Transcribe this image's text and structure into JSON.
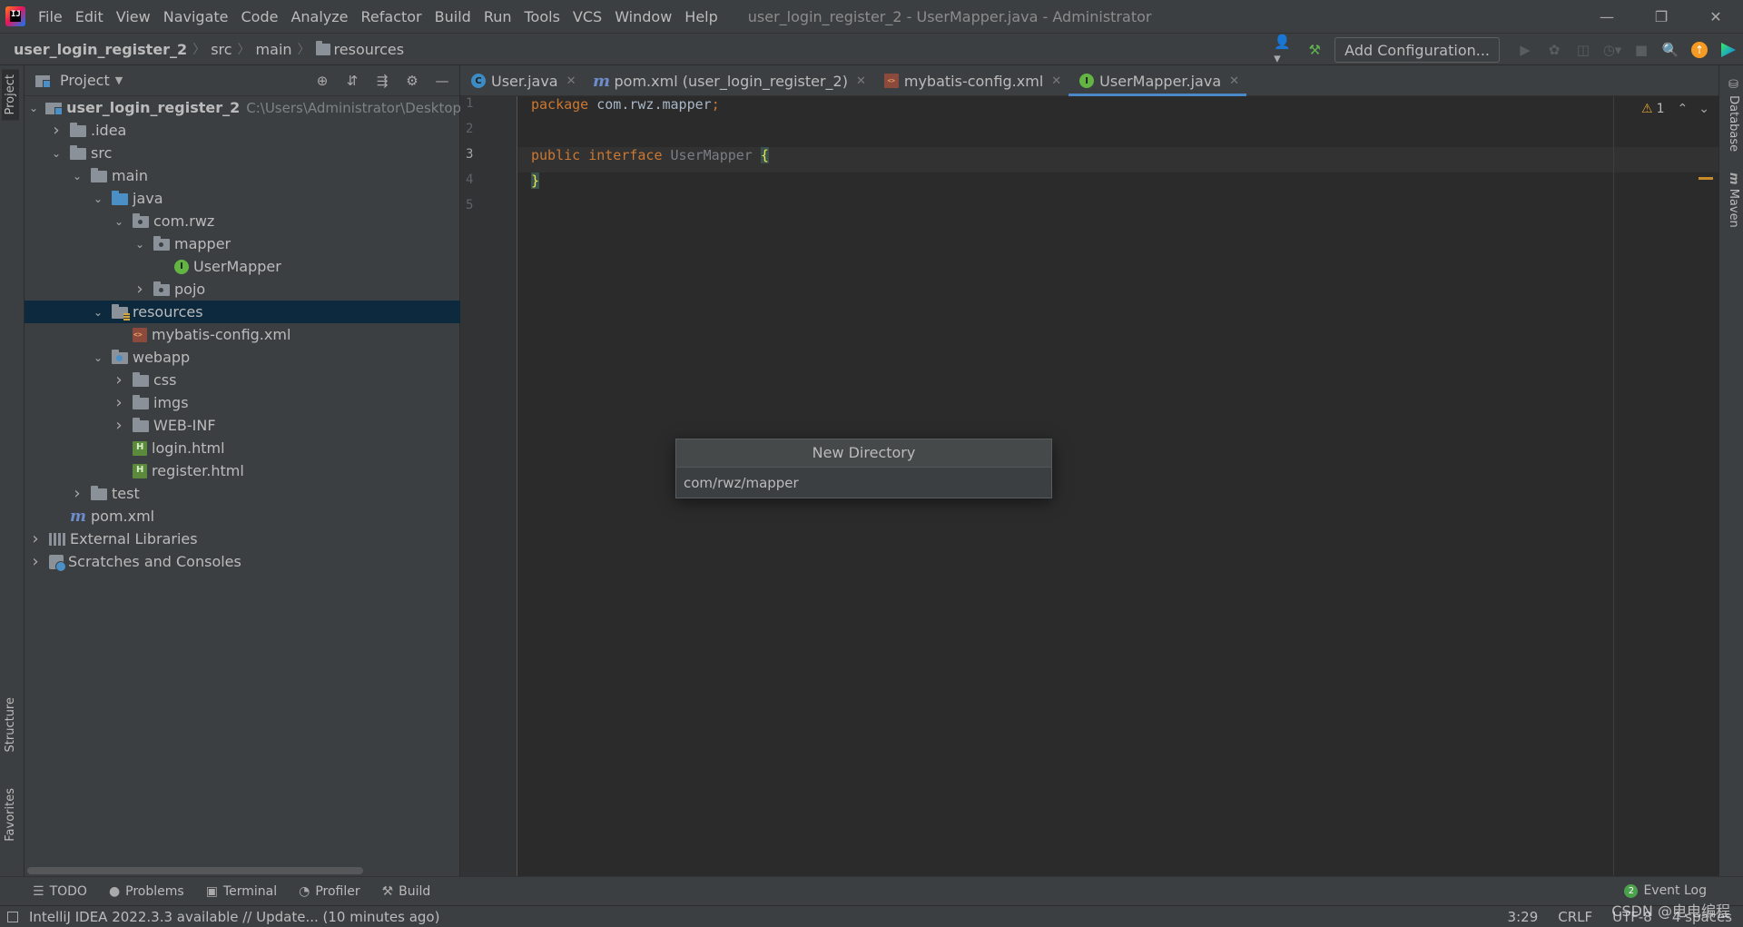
{
  "app": {
    "logo_text": "IJ",
    "window_title": "user_login_register_2 - UserMapper.java - Administrator"
  },
  "menu": [
    "File",
    "Edit",
    "View",
    "Navigate",
    "Code",
    "Analyze",
    "Refactor",
    "Build",
    "Run",
    "Tools",
    "VCS",
    "Window",
    "Help"
  ],
  "breadcrumb": [
    "user_login_register_2",
    "src",
    "main",
    "resources"
  ],
  "toolbar": {
    "add_configuration": "Add Configuration..."
  },
  "stripes": {
    "project": "Project",
    "structure": "Structure",
    "favorites": "Favorites",
    "database": "Database",
    "maven": "Maven"
  },
  "project": {
    "title": "Project",
    "tree": [
      {
        "label": "user_login_register_2",
        "path": "C:\\Users\\Administrator\\Desktop\\user",
        "depth": 0,
        "expanded": true,
        "icon": "module-folder-icon",
        "bold": true
      },
      {
        "label": ".idea",
        "depth": 1,
        "expanded": false,
        "icon": "folder-icon"
      },
      {
        "label": "src",
        "depth": 1,
        "expanded": true,
        "icon": "folder-icon"
      },
      {
        "label": "main",
        "depth": 2,
        "expanded": true,
        "icon": "folder-icon"
      },
      {
        "label": "java",
        "depth": 3,
        "expanded": true,
        "icon": "source-folder-icon"
      },
      {
        "label": "com.rwz",
        "depth": 4,
        "expanded": true,
        "icon": "package-icon"
      },
      {
        "label": "mapper",
        "depth": 5,
        "expanded": true,
        "icon": "package-icon"
      },
      {
        "label": "UserMapper",
        "depth": 6,
        "leaf": true,
        "icon": "interface-icon"
      },
      {
        "label": "pojo",
        "depth": 5,
        "expanded": false,
        "icon": "package-icon"
      },
      {
        "label": "resources",
        "depth": 3,
        "expanded": true,
        "icon": "resources-folder-icon",
        "selected": true
      },
      {
        "label": "mybatis-config.xml",
        "depth": 4,
        "leaf": true,
        "icon": "xml-file-icon"
      },
      {
        "label": "webapp",
        "depth": 3,
        "expanded": true,
        "icon": "web-folder-icon"
      },
      {
        "label": "css",
        "depth": 4,
        "expanded": false,
        "icon": "folder-icon"
      },
      {
        "label": "imgs",
        "depth": 4,
        "expanded": false,
        "icon": "folder-icon"
      },
      {
        "label": "WEB-INF",
        "depth": 4,
        "expanded": false,
        "icon": "folder-icon"
      },
      {
        "label": "login.html",
        "depth": 4,
        "leaf": true,
        "icon": "html-file-icon"
      },
      {
        "label": "register.html",
        "depth": 4,
        "leaf": true,
        "icon": "html-file-icon"
      },
      {
        "label": "test",
        "depth": 2,
        "expanded": false,
        "icon": "folder-icon"
      },
      {
        "label": "pom.xml",
        "depth": 1,
        "leaf": true,
        "icon": "maven-file-icon"
      },
      {
        "label": "External Libraries",
        "depth": 0,
        "expanded": false,
        "icon": "libraries-icon"
      },
      {
        "label": "Scratches and Consoles",
        "depth": 0,
        "expanded": false,
        "icon": "scratches-icon"
      }
    ]
  },
  "editor": {
    "tabs": [
      {
        "label": "User.java",
        "icon": "class-icon",
        "glyph": "C",
        "kind": "c",
        "active": false
      },
      {
        "label": "pom.xml (user_login_register_2)",
        "icon": "maven-icon",
        "glyph": "m",
        "kind": "m",
        "active": false
      },
      {
        "label": "mybatis-config.xml",
        "icon": "xml-icon",
        "glyph": "<>",
        "kind": "x",
        "active": false
      },
      {
        "label": "UserMapper.java",
        "icon": "interface-icon",
        "glyph": "I",
        "kind": "i",
        "active": true
      }
    ],
    "line_numbers": [
      "1",
      "2",
      "3",
      "4",
      "5"
    ],
    "current_line": 3,
    "code": {
      "line1_kw": "package",
      "line1_rest": " com.rwz.mapper",
      "line1_semi": ";",
      "line3_kw1": "public",
      "line3_kw2": "interface",
      "line3_name": "UserMapper",
      "open_brace": "{",
      "close_brace": "}"
    },
    "inspection": {
      "warnings": "1"
    }
  },
  "popup": {
    "title": "New Directory",
    "value": "com/rwz/mapper"
  },
  "bottom_tools": [
    {
      "label": "TODO",
      "icon": "list-icon",
      "glyph": "☰"
    },
    {
      "label": "Problems",
      "icon": "problems-icon",
      "glyph": "●"
    },
    {
      "label": "Terminal",
      "icon": "terminal-icon",
      "glyph": "▣"
    },
    {
      "label": "Profiler",
      "icon": "profiler-icon",
      "glyph": "◔"
    },
    {
      "label": "Build",
      "icon": "hammer-icon",
      "glyph": "⚒"
    }
  ],
  "event_log": {
    "count": "2",
    "label": "Event Log"
  },
  "status": {
    "message": "IntelliJ IDEA 2022.3.3 available // Update... (10 minutes ago)",
    "position": "3:29",
    "line_sep": "CRLF",
    "encoding": "UTF-8",
    "indent": "4 spaces"
  },
  "watermark": "CSDN @电电编程"
}
